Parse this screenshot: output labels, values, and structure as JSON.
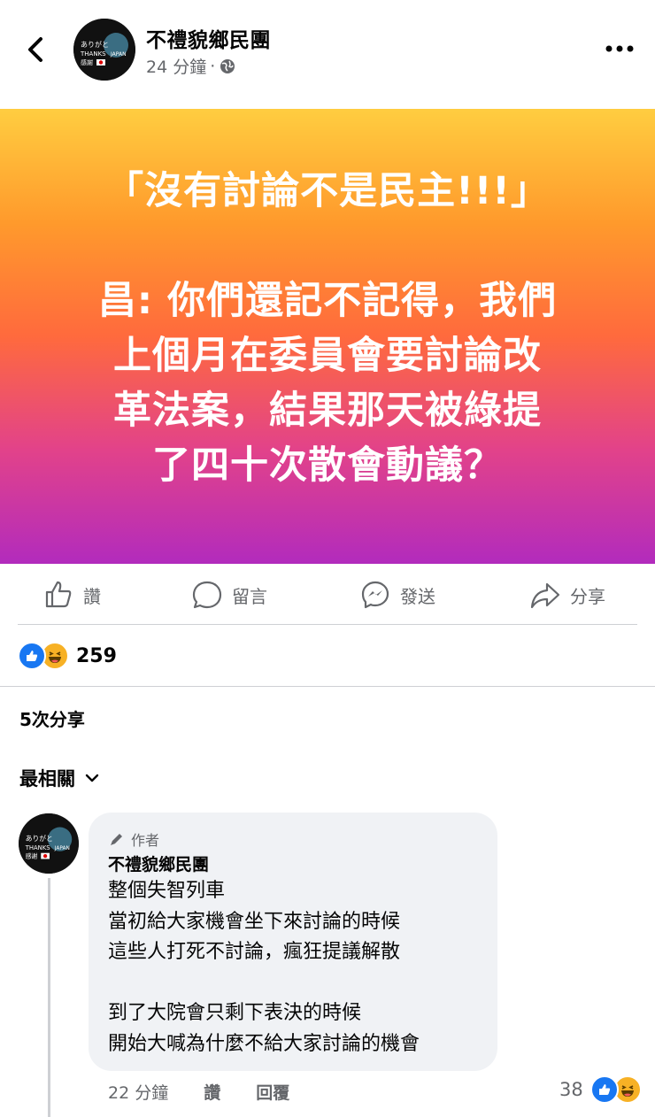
{
  "header": {
    "page_name": "不禮貌鄉民團",
    "time": "24 分鐘",
    "separator": "·",
    "avatar_text": [
      "ありがと",
      "THANKS",
      "JAPAN",
      "感謝"
    ]
  },
  "post": {
    "text": "「沒有討論不是民主!!!」\n\n昌: 你們還記不記得，我們\n上個月在委員會要討論改\n革法案，結果那天被綠提\n了四十次散會動議？",
    "gradient": [
      "#ffcd40",
      "#ff6a3d",
      "#b22bbd"
    ]
  },
  "actions": {
    "like": "讚",
    "comment": "留言",
    "send": "發送",
    "share": "分享"
  },
  "reactions": {
    "count": "259",
    "types": [
      "like-icon",
      "haha-icon"
    ]
  },
  "shares": "5次分享",
  "sort_label": "最相關",
  "comment": {
    "badge": "作者",
    "author": "不禮貌鄉民團",
    "text": "整個失智列車\n當初給大家機會坐下來討論的時候\n這些人打死不討論，瘋狂提議解散\n\n到了大院會只剩下表決的時候\n開始大喊為什麼不給大家討論的機會",
    "time": "22 分鐘",
    "like": "讚",
    "reply": "回覆",
    "reaction_count": "38"
  },
  "colors": {
    "accent": "#1877f2",
    "muted": "#65676b",
    "bubble": "#f0f2f5"
  }
}
